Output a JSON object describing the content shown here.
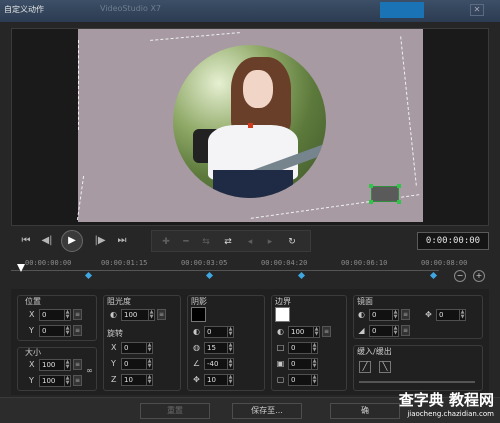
{
  "window": {
    "title": "自定义动作",
    "ghost_title": "VideoStudio X7"
  },
  "player": {
    "timecode": "0:00:00:00",
    "buttons": [
      "⏮",
      "◀|",
      "▶",
      "|▶",
      "⏭"
    ]
  },
  "ruler": {
    "ticks": [
      "00:00:00:00",
      "00:00:01:15",
      "00:00:03:05",
      "00:00:04:20",
      "00:00:06:10",
      "00:00:08:00"
    ]
  },
  "position": {
    "label": "位置",
    "x_label": "X",
    "x": "0",
    "y_label": "Y",
    "y": "0"
  },
  "size": {
    "label": "大小",
    "x_label": "X",
    "x": "100",
    "y_label": "Y",
    "y": "100"
  },
  "opacity": {
    "label": "阻光度",
    "value": "100"
  },
  "rotation": {
    "label": "旋转",
    "x_label": "X",
    "x": "0",
    "y_label": "Y",
    "y": "0",
    "z_label": "Z",
    "z": "10"
  },
  "shadow": {
    "label": "阴影",
    "color": "#000000",
    "v1": "0",
    "v2": "15",
    "v3": "-40",
    "v4": "10"
  },
  "border": {
    "label": "边界",
    "color": "#ffffff",
    "v1": "100",
    "v2": "0",
    "v3": "0",
    "v4": "0"
  },
  "mirror": {
    "label": "镜面",
    "v1": "0",
    "v2": "0",
    "v3": "0"
  },
  "fade": {
    "label": "缓入/缓出"
  },
  "footer": {
    "reset": "重置",
    "save": "保存至...",
    "ok": "确"
  },
  "watermark": {
    "main": "查字典 教程网",
    "sub": "jiaocheng.chazidian.com"
  },
  "colors": {
    "canvas": "#a79aa3",
    "keyframe": "#3fa6e0",
    "titlebar": "#2c3c52"
  }
}
